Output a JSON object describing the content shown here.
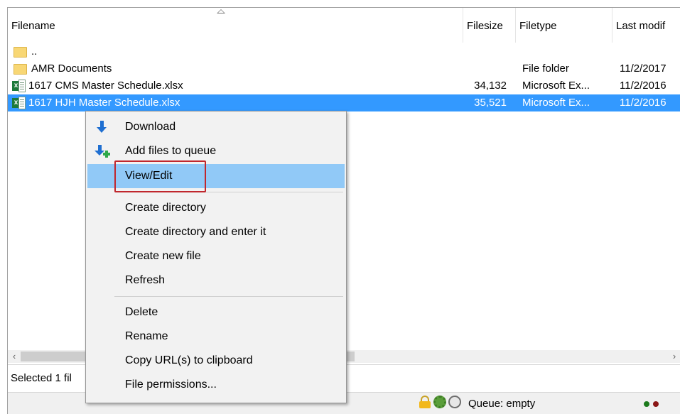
{
  "columns": {
    "filename": "Filename",
    "filesize": "Filesize",
    "filetype": "Filetype",
    "last_modified": "Last modif"
  },
  "files": [
    {
      "name": "..",
      "size": "",
      "type": "",
      "date": "",
      "icon": "folder-icon"
    },
    {
      "name": "AMR Documents",
      "size": "",
      "type": "File folder",
      "date": "11/2/2017",
      "icon": "folder-icon"
    },
    {
      "name": "1617 CMS Master Schedule.xlsx",
      "size": "34,132",
      "type": "Microsoft Ex...",
      "date": "11/2/2016",
      "icon": "excel-file-icon"
    },
    {
      "name": "1617 HJH Master Schedule.xlsx",
      "size": "35,521",
      "type": "Microsoft Ex...",
      "date": "11/2/2016",
      "icon": "excel-file-icon",
      "selected": true
    }
  ],
  "context_menu": {
    "items": [
      {
        "label": "Download",
        "icon": "download-arrow-icon"
      },
      {
        "label": "Add files to queue",
        "icon": "add-to-queue-icon"
      },
      {
        "label": "View/Edit",
        "highlighted": true
      },
      {
        "label": "Create directory"
      },
      {
        "label": "Create directory and enter it"
      },
      {
        "label": "Create new file"
      },
      {
        "label": "Refresh"
      },
      {
        "label": "Delete"
      },
      {
        "label": "Rename"
      },
      {
        "label": "Copy URL(s) to clipboard"
      },
      {
        "label": "File permissions..."
      }
    ]
  },
  "status": {
    "selection_text": "Selected 1 fil"
  },
  "queue": {
    "label": "Queue: empty"
  },
  "colors": {
    "selection": "#3399ff",
    "menu_highlight": "#91c9f7",
    "annotation_box": "#c0272d"
  }
}
